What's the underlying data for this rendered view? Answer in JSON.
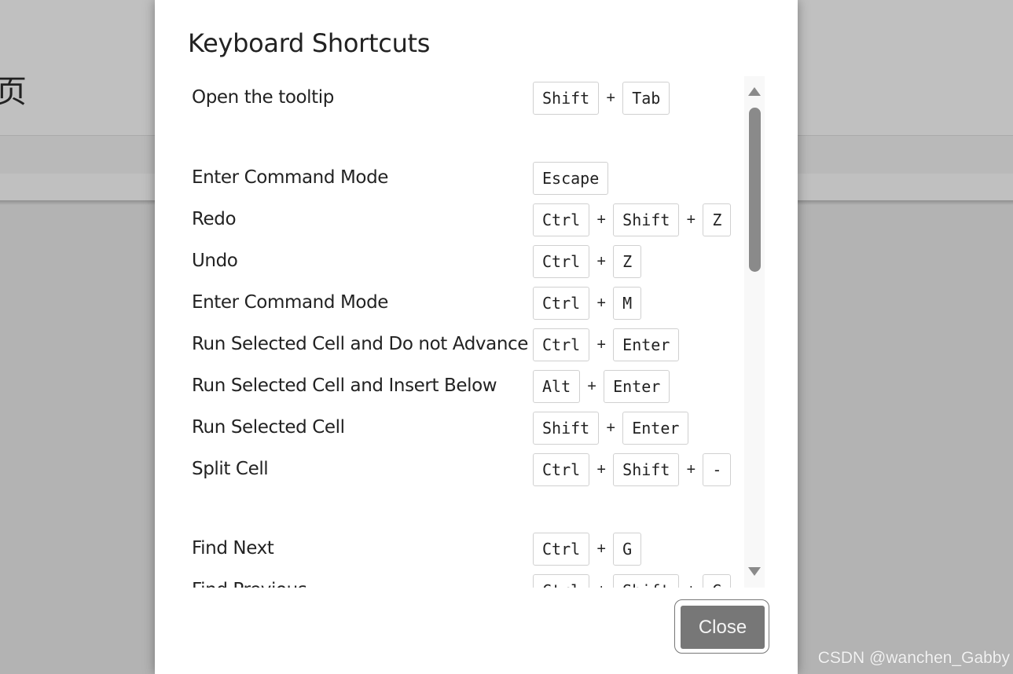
{
  "background": {
    "glyph": "页"
  },
  "dialog": {
    "title": "Keyboard Shortcuts",
    "close_label": "Close",
    "shortcuts": [
      {
        "label": "Open the tooltip",
        "keys": [
          "Shift",
          "Tab"
        ]
      },
      {
        "label": "Enter Command Mode",
        "keys": [
          "Escape"
        ]
      },
      {
        "label": "Redo",
        "keys": [
          "Ctrl",
          "Shift",
          "Z"
        ]
      },
      {
        "label": "Undo",
        "keys": [
          "Ctrl",
          "Z"
        ]
      },
      {
        "label": "Enter Command Mode",
        "keys": [
          "Ctrl",
          "M"
        ]
      },
      {
        "label": "Run Selected Cell and Do not Advance",
        "keys": [
          "Ctrl",
          "Enter"
        ]
      },
      {
        "label": "Run Selected Cell and Insert Below",
        "keys": [
          "Alt",
          "Enter"
        ]
      },
      {
        "label": "Run Selected Cell",
        "keys": [
          "Shift",
          "Enter"
        ]
      },
      {
        "label": "Split Cell",
        "keys": [
          "Ctrl",
          "Shift",
          "-"
        ]
      },
      {
        "label": "Find Next",
        "keys": [
          "Ctrl",
          "G"
        ]
      },
      {
        "label": "Find Previous",
        "keys": [
          "Ctrl",
          "Shift",
          "G"
        ]
      }
    ],
    "separator": "+"
  },
  "watermark": "CSDN @wanchen_Gabby"
}
